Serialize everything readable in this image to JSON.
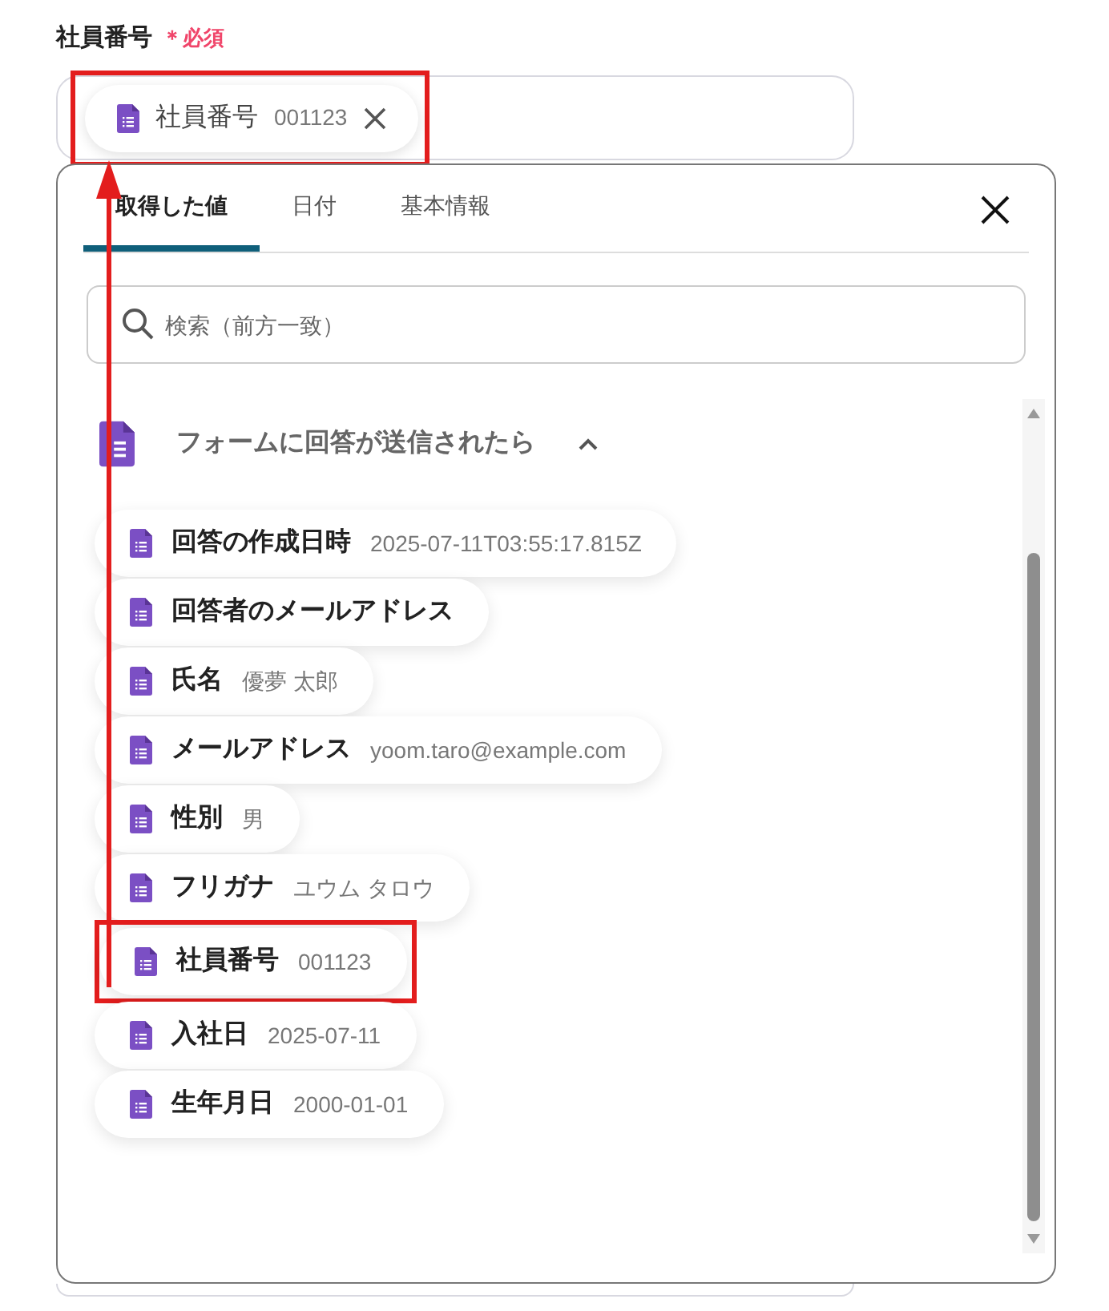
{
  "field": {
    "label": "社員番号",
    "required_mark": "＊必須",
    "chip": {
      "name": "社員番号",
      "value": "001123",
      "removable": true,
      "highlighted": true
    }
  },
  "picker": {
    "tabs": [
      {
        "label": "取得した値",
        "selected": true
      },
      {
        "label": "日付",
        "selected": false
      },
      {
        "label": "基本情報",
        "selected": false
      }
    ],
    "search": {
      "placeholder": "検索（前方一致）"
    },
    "group": {
      "title": "フォームに回答が送信されたら",
      "expanded": true
    },
    "items": [
      {
        "name": "回答の作成日時",
        "value": "2025-07-11T03:55:17.815Z",
        "highlighted": false
      },
      {
        "name": "回答者のメールアドレス",
        "highlighted": false
      },
      {
        "name": "氏名",
        "value": "優夢 太郎",
        "highlighted": false
      },
      {
        "name": "メールアドレス",
        "value": "yoom.taro@example.com",
        "highlighted": false
      },
      {
        "name": "性別",
        "value": "男",
        "highlighted": false
      },
      {
        "name": "フリガナ",
        "value": "ユウム タロウ",
        "highlighted": false
      },
      {
        "name": "社員番号",
        "value": "001123",
        "highlighted": true
      },
      {
        "name": "入社日",
        "value": "2025-07-11",
        "highlighted": false
      },
      {
        "name": "生年月日",
        "value": "2000-01-01",
        "highlighted": false
      }
    ]
  },
  "annotation": {
    "arrow": true
  }
}
